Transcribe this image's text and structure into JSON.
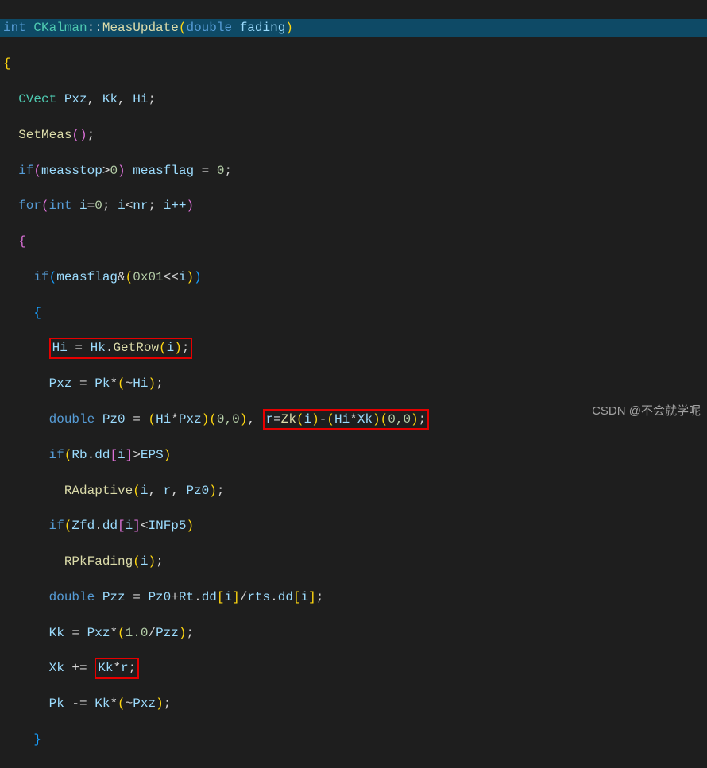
{
  "signature": {
    "ret": "int",
    "cls": "CKalman",
    "scope": "::",
    "fn": "MeasUpdate",
    "param_type": "double",
    "param_name": "fading"
  },
  "decl": {
    "type": "CVect",
    "v1": "Pxz",
    "v2": "Kk",
    "v3": "Hi"
  },
  "setmeas": "SetMeas",
  "cond1": {
    "kw": "if",
    "lhs": "measstop",
    "op": ">",
    "rhs": "0",
    "assign_lhs": "measflag",
    "assign_rhs": "0"
  },
  "forloop": {
    "kw": "for",
    "type": "int",
    "var": "i",
    "init": "0",
    "cmpop": "<",
    "limit": "nr",
    "inc": "i++"
  },
  "inner_if": {
    "kw": "if",
    "lhs": "measflag",
    "op": "&",
    "hex": "0x01",
    "shift": "<<",
    "idx": "i"
  },
  "hi_assign": {
    "lhs": "Hi",
    "obj": "Hk",
    "method": "GetRow",
    "arg": "i"
  },
  "pxz_assign": {
    "lhs": "Pxz",
    "a": "Pk",
    "op": "*",
    "tilde": "~",
    "b": "Hi"
  },
  "pz0": {
    "type": "double",
    "lhs": "Pz0",
    "a": "Hi",
    "b": "Pxz",
    "idx": "0,0",
    "r": "r",
    "zk": "Zk",
    "zki": "i",
    "hi": "Hi",
    "xk": "Xk",
    "idx2": "0,0"
  },
  "rb_if": {
    "kw": "if",
    "obj": "Rb",
    "mem": "dd",
    "idx": "i",
    "op": ">",
    "rhs": "EPS"
  },
  "radapt": {
    "fn": "RAdaptive",
    "a1": "i",
    "a2": "r",
    "a3": "Pz0"
  },
  "zfd_if": {
    "kw": "if",
    "obj": "Zfd",
    "mem": "dd",
    "idx": "i",
    "op": "<",
    "rhs": "INFp5"
  },
  "rpkf": {
    "fn": "RPkFading",
    "arg": "i"
  },
  "pzz": {
    "type": "double",
    "lhs": "Pzz",
    "a": "Pz0",
    "rt": "Rt",
    "mem": "dd",
    "idx": "i",
    "rts": "rts",
    "mem2": "dd",
    "idx2": "i"
  },
  "kk": {
    "lhs": "Kk",
    "a": "Pxz",
    "one": "1.0",
    "b": "Pzz"
  },
  "xk": {
    "lhs": "Xk",
    "op": "+=",
    "a": "Kk",
    "b": "r"
  },
  "pk": {
    "lhs": "Pk",
    "op": "-=",
    "a": "Kk",
    "tilde": "~",
    "b": "Pxz"
  },
  "watermark": "CSDN @不会就学呢"
}
